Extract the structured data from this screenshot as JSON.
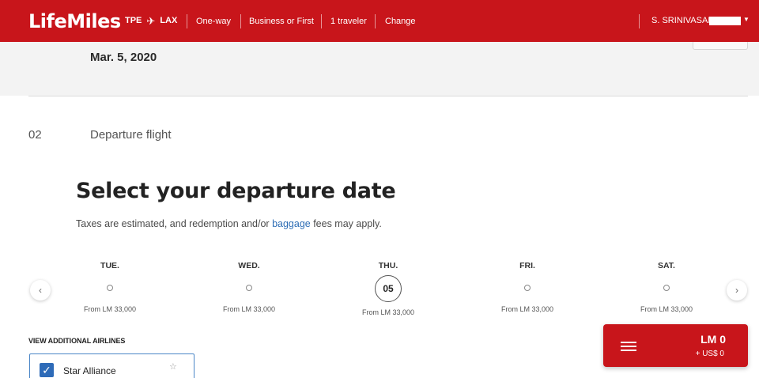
{
  "header": {
    "logo": "LifeMiles",
    "origin": "TPE",
    "destination": "LAX",
    "plane_icon": "plane-icon",
    "trip_type": "One-way",
    "cabin": "Business or First",
    "travelers": "1 traveler",
    "change_label": "Change",
    "user_name": "S. SRINIVASAN",
    "brand_color": "#c8151b"
  },
  "summary": {
    "date": "Mar. 5, 2020"
  },
  "step": {
    "number": "02",
    "label": "Departure flight"
  },
  "main": {
    "title": "Select your departure date",
    "subtext_before": "Taxes are estimated, and redemption and/or ",
    "subtext_link": "baggage",
    "subtext_after": " fees may apply."
  },
  "carousel": {
    "prev_icon": "chevron-left-icon",
    "next_icon": "chevron-right-icon",
    "days": [
      {
        "name": "TUE.",
        "date": "",
        "price": "From LM 33,000",
        "selected": false
      },
      {
        "name": "WED.",
        "date": "",
        "price": "From LM 33,000",
        "selected": false
      },
      {
        "name": "THU.",
        "date": "05",
        "price": "From LM 33,000",
        "selected": true
      },
      {
        "name": "FRI.",
        "date": "",
        "price": "From LM 33,000",
        "selected": false
      },
      {
        "name": "SAT.",
        "date": "",
        "price": "From LM 33,000",
        "selected": false
      }
    ]
  },
  "airlines": {
    "title": "VIEW ADDITIONAL AIRLINES",
    "options": [
      {
        "label": "Star Alliance",
        "checked": true
      }
    ]
  },
  "total": {
    "miles": "LM 0",
    "usd": "+ US$ 0"
  }
}
